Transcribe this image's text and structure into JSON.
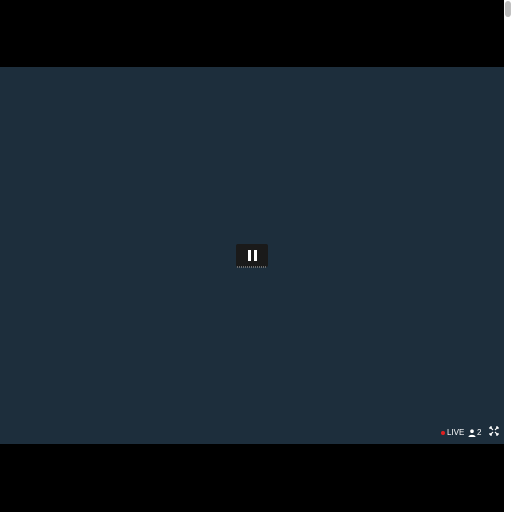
{
  "player": {
    "state": "paused",
    "pause_icon": "pause-icon",
    "colors": {
      "video_background": "#1d2e3c",
      "letterbox": "#000000",
      "live_indicator": "#e02020",
      "control_background": "#1a1a1a"
    }
  },
  "status": {
    "live_label": "LIVE",
    "viewer_count": "2",
    "viewer_icon": "person-icon",
    "fullscreen_icon": "fullscreen-icon"
  }
}
